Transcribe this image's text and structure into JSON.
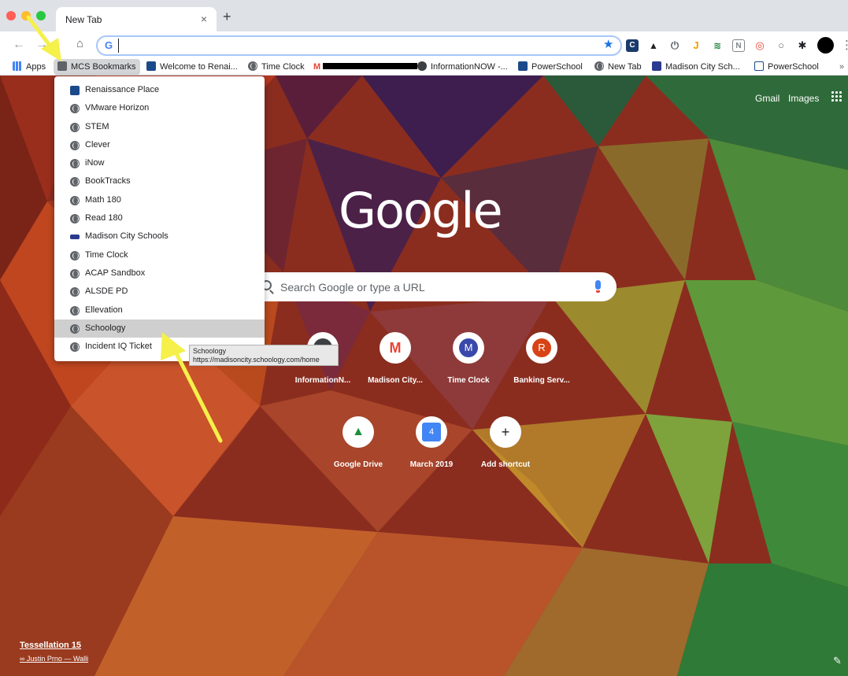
{
  "window": {
    "tab_title": "New Tab",
    "tab_close": "×",
    "new_tab_button": "+"
  },
  "toolbar": {
    "back": "←",
    "forward": "→",
    "reload": "↻",
    "home": "⌂",
    "omnibox_prefix": "G",
    "omnibox_value": "",
    "star": "★",
    "kebab": "⋮",
    "extensions": [
      {
        "label": "C",
        "color": "#1a3a6b"
      },
      {
        "label": "▲",
        "color": "#202124"
      },
      {
        "label": "⏻",
        "color": "#5f6368"
      },
      {
        "label": "J",
        "color": "#f29900"
      },
      {
        "label": "≋",
        "color": "#188038"
      },
      {
        "label": "N",
        "color": "#80868b"
      },
      {
        "label": "◎",
        "color": "#ea4335"
      },
      {
        "label": "○",
        "color": "#5f6368"
      },
      {
        "label": "✱",
        "color": "#202124"
      }
    ]
  },
  "bookmarks_bar": {
    "items": [
      {
        "label": "Apps"
      },
      {
        "label": "MCS Bookmarks"
      },
      {
        "label": "Welcome to Renai..."
      },
      {
        "label": "Time Clock"
      },
      {
        "label": "[redacted]"
      },
      {
        "label": "InformationNOW -..."
      },
      {
        "label": "PowerSchool"
      },
      {
        "label": "New Tab"
      },
      {
        "label": "Madison City Sch..."
      },
      {
        "label": "PowerSchool"
      }
    ],
    "overflow": "»"
  },
  "folder_menu": {
    "items": [
      {
        "label": "Renaissance Place",
        "icon": "renaissance-icon"
      },
      {
        "label": "VMware Horizon",
        "icon": "globe-icon"
      },
      {
        "label": "STEM",
        "icon": "globe-icon"
      },
      {
        "label": "Clever",
        "icon": "globe-icon"
      },
      {
        "label": "iNow",
        "icon": "globe-icon"
      },
      {
        "label": "BookTracks",
        "icon": "globe-icon"
      },
      {
        "label": "Math 180",
        "icon": "globe-icon"
      },
      {
        "label": "Read 180",
        "icon": "globe-icon"
      },
      {
        "label": "Madison City Schools",
        "icon": "madison-icon"
      },
      {
        "label": "Time Clock",
        "icon": "globe-icon"
      },
      {
        "label": "ACAP Sandbox",
        "icon": "globe-icon"
      },
      {
        "label": "ALSDE PD",
        "icon": "globe-icon"
      },
      {
        "label": "Ellevation",
        "icon": "globe-icon"
      },
      {
        "label": "Schoology",
        "icon": "globe-icon"
      },
      {
        "label": "Incident IQ Ticket",
        "icon": "globe-icon"
      }
    ],
    "hovered_index": 13
  },
  "tooltip": {
    "title": "Schoology",
    "url": "https://madisoncity.schoology.com/home"
  },
  "ntp": {
    "gmail": "Gmail",
    "images": "Images",
    "logo": "Google",
    "search_placeholder": "Search Google or type a URL",
    "shortcuts": [
      {
        "label": "InformationN...",
        "letter": "",
        "color": "#3c4043"
      },
      {
        "label": "Madison City...",
        "letter": "M",
        "color": "#ea4335"
      },
      {
        "label": "Time Clock",
        "letter": "M",
        "color": "#3949ab"
      },
      {
        "label": "Banking Serv...",
        "letter": "R",
        "color": "#d84315"
      },
      {
        "label": "Google Drive",
        "letter": "▲",
        "color": "#1e8e3e"
      },
      {
        "label": "March 2019",
        "letter": "4",
        "color": "#4285f4"
      },
      {
        "label": "Add shortcut",
        "letter": "+",
        "color": "#ffffff"
      }
    ],
    "credit_title": "Tessellation 15",
    "credit_author": "∞ Justin Prno — Walli",
    "edit": "✎"
  }
}
